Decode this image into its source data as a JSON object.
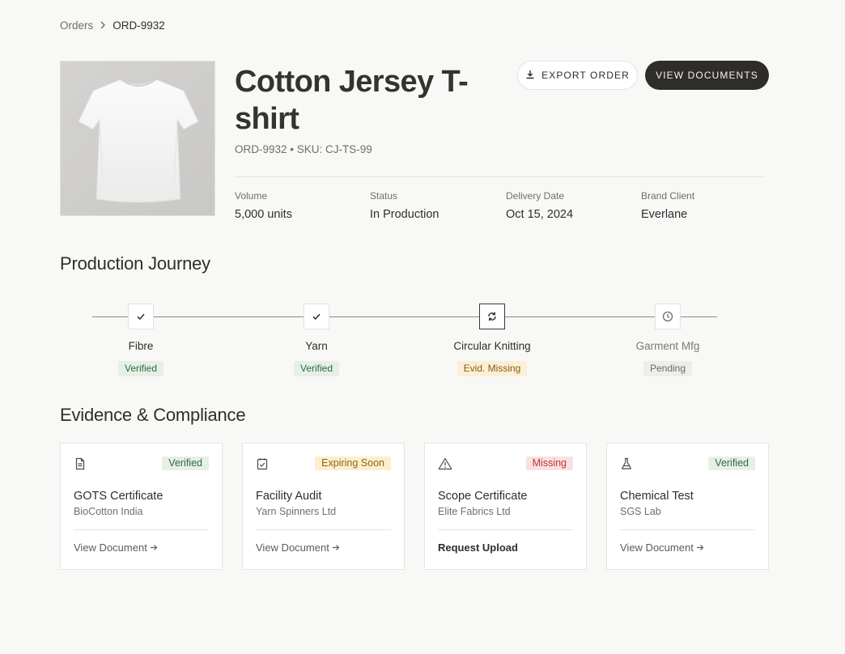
{
  "breadcrumb": {
    "parent": "Orders",
    "current": "ORD-9932"
  },
  "product": {
    "title": "Cotton Jersey T-shirt",
    "subtitle": "ORD-9932 • SKU: CJ-TS-99",
    "image_icon": "tshirt-photo"
  },
  "actions": {
    "export_label": "EXPORT ORDER",
    "export_icon": "download-icon",
    "documents_label": "VIEW DOCUMENTS"
  },
  "meta": [
    {
      "label": "Volume",
      "value": "5,000 units"
    },
    {
      "label": "Status",
      "value": "In Production"
    },
    {
      "label": "Delivery Date",
      "value": "Oct 15, 2024"
    },
    {
      "label": "Brand Client",
      "value": "Everlane"
    }
  ],
  "journey": {
    "title": "Production Journey",
    "steps": [
      {
        "label": "Fibre",
        "badge": "Verified",
        "icon": "check-icon",
        "state": "verified"
      },
      {
        "label": "Yarn",
        "badge": "Verified",
        "icon": "check-icon",
        "state": "verified"
      },
      {
        "label": "Circular Knitting",
        "badge": "Evid. Missing",
        "icon": "refresh-icon",
        "state": "missing"
      },
      {
        "label": "Garment Mfg",
        "badge": "Pending",
        "icon": "clock-icon",
        "state": "pending"
      }
    ]
  },
  "evidence": {
    "title": "Evidence & Compliance",
    "cards": [
      {
        "title": "GOTS Certificate",
        "issuer": "BioCotton India",
        "badge": "Verified",
        "icon": "document-icon",
        "link": "View Document"
      },
      {
        "title": "Facility Audit",
        "issuer": "Yarn Spinners Ltd",
        "badge": "Expiring Soon",
        "icon": "clipboard-check-icon",
        "link": "View Document"
      },
      {
        "title": "Scope Certificate",
        "issuer": "Elite Fabrics Ltd",
        "badge": "Missing",
        "icon": "warning-icon",
        "link": "Request Upload"
      },
      {
        "title": "Chemical Test",
        "issuer": "SGS Lab",
        "badge": "Verified",
        "icon": "flask-icon",
        "link": "View Document"
      }
    ]
  },
  "colors": {
    "accent_dark": "#2e2d29",
    "verified": "#2f6a3c",
    "warning": "#8f6316",
    "danger": "#b23b3b",
    "background": "#f8f8f7"
  }
}
